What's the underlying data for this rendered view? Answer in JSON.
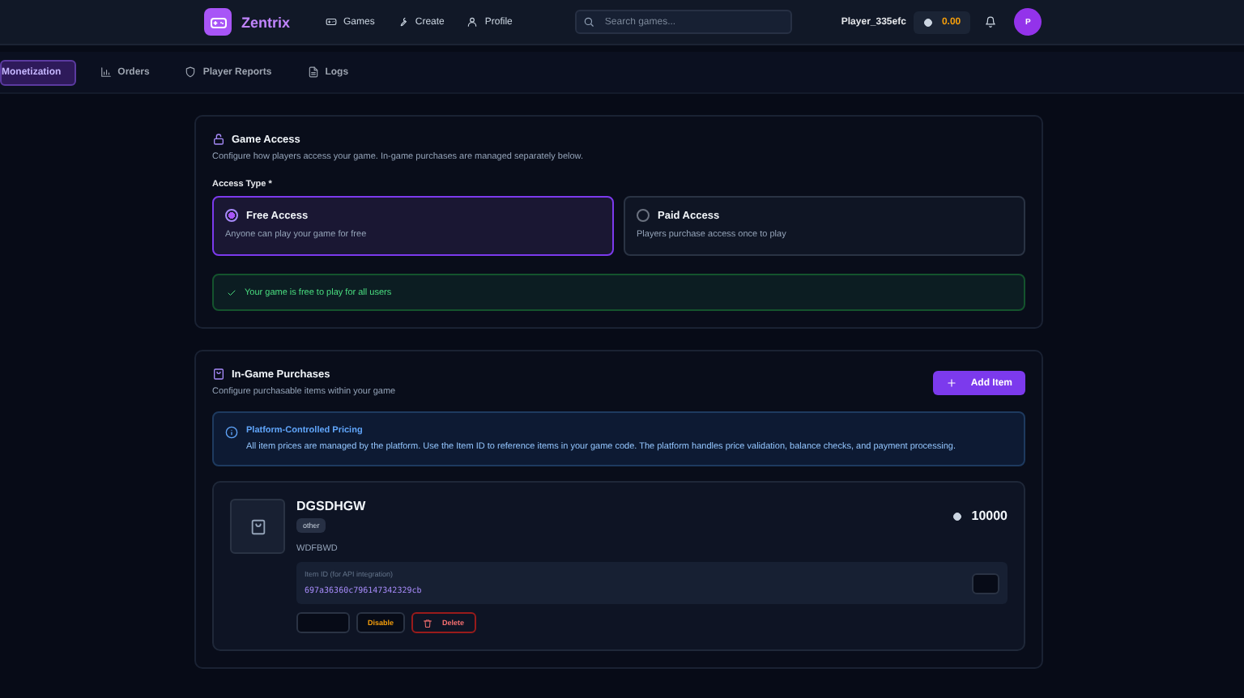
{
  "header": {
    "brand": "Zentrix",
    "nav": [
      {
        "label": "Games"
      },
      {
        "label": "Create"
      },
      {
        "label": "Profile"
      }
    ],
    "search": {
      "placeholder": "Search games..."
    },
    "username": "Player_335efc",
    "balance": "0.00",
    "avatar_initial": "P"
  },
  "tabs": [
    {
      "label": "Monetization",
      "selected": true
    },
    {
      "label": "Orders",
      "selected": false
    },
    {
      "label": "Player Reports",
      "selected": false
    },
    {
      "label": "Logs",
      "selected": false
    }
  ],
  "game_access": {
    "title": "Game Access",
    "description": "Configure how players access your game. In-game purchases are managed separately below.",
    "field_label": "Access Type *",
    "options": [
      {
        "title": "Free Access",
        "description": "Anyone can play your game for free",
        "selected": true
      },
      {
        "title": "Paid Access",
        "description": "Players purchase access once to play",
        "selected": false
      }
    ],
    "notice": "Your game is free to play for all users"
  },
  "purchases": {
    "title": "In-Game Purchases",
    "description": "Configure purchasable items within your game",
    "add_button": "Add Item",
    "info": {
      "title": "Platform-Controlled Pricing",
      "text": "All item prices are managed by the platform. Use the Item ID to reference items in your game code. The platform handles price validation, balance checks, and payment processing."
    },
    "items": [
      {
        "name": "DGSDHGW",
        "category": "other",
        "price": "10000",
        "description": "WDFBWD",
        "id_label": "Item ID (for API integration)",
        "item_id": "697a36360c796147342329cb",
        "disable_button": "Disable",
        "delete_button": "Delete"
      }
    ]
  }
}
